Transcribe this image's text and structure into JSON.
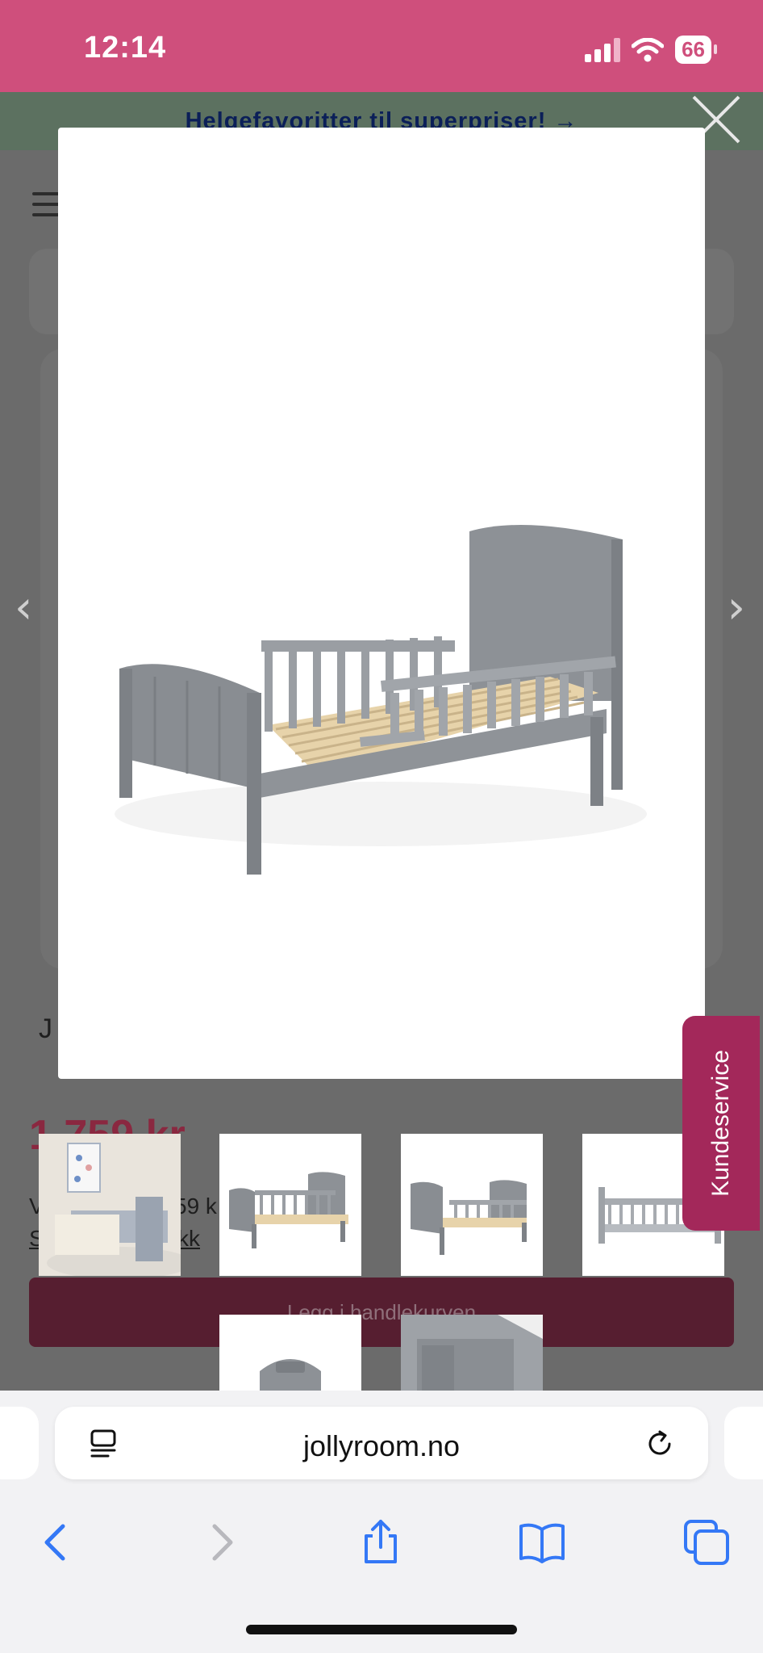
{
  "status_bar": {
    "time": "12:14",
    "battery": "66",
    "icons": [
      "signal-icon",
      "wifi-icon",
      "battery-icon"
    ]
  },
  "page": {
    "promo_banner": "Helgefavoritter til superpriser! →",
    "product_title_partial": "J",
    "price_partial": "1 759 kr",
    "subprice_partial": "V",
    "subprice_tail": "59 k",
    "link_partial": "S",
    "link_tail": "kk",
    "cart_button": "Legg i handlekurven"
  },
  "modal": {
    "image_alt": "Grey toddler bed with side rails and wooden slats",
    "thumbnails": [
      {
        "alt": "Bed in room setting"
      },
      {
        "alt": "Bed side view"
      },
      {
        "alt": "Bed angled view"
      },
      {
        "alt": "Bed front view"
      },
      {
        "alt": "Bed headboard detail"
      },
      {
        "alt": "Bed corner detail"
      }
    ]
  },
  "kundeservice": "Kundeservice",
  "browser": {
    "url": "jollyroom.no"
  },
  "colors": {
    "status_bar": "#cf4f7c",
    "kundeservice": "#a3285a",
    "cart_button": "#561e30",
    "browser_accent": "#3478f6"
  }
}
